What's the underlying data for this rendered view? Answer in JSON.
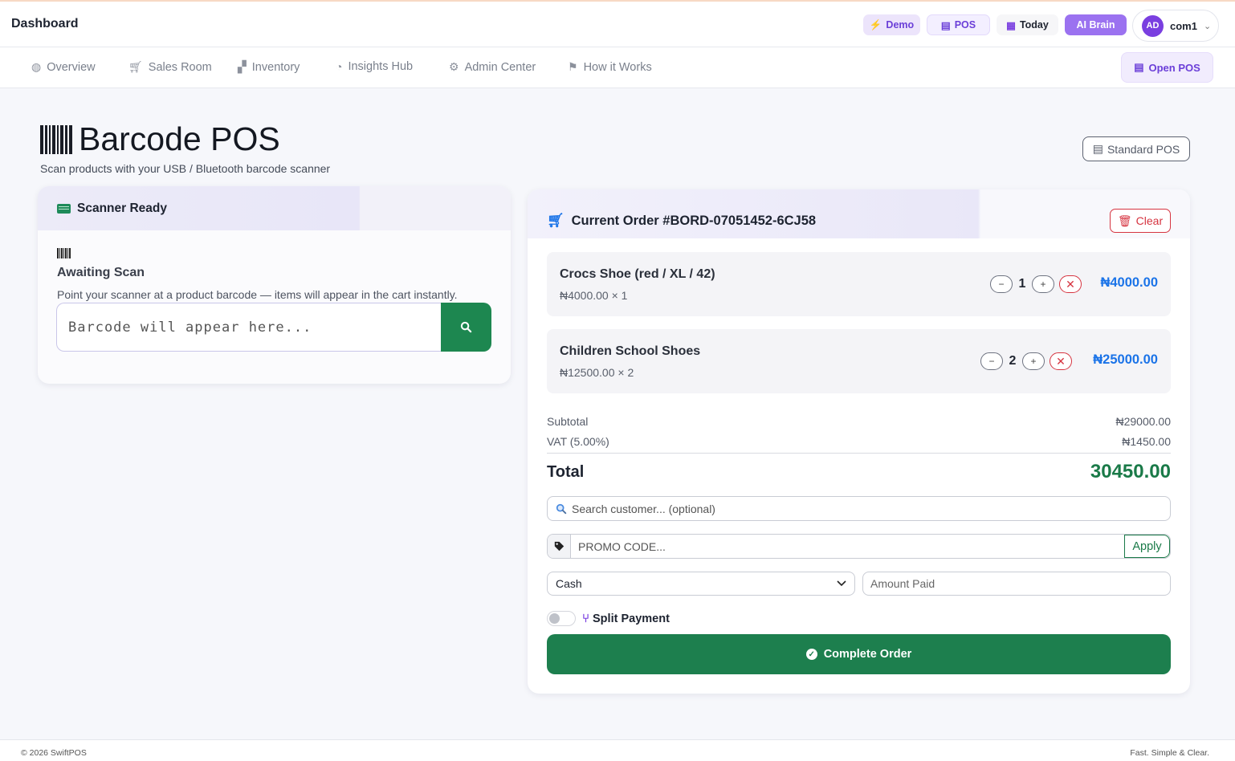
{
  "header": {
    "title": "Dashboard",
    "demo_label": "Demo",
    "pos_label": "POS",
    "today_label": "Today",
    "ai_label": "AI Brain",
    "user_initials": "AD",
    "user_name": "com1"
  },
  "nav": {
    "items": [
      {
        "label": "Overview",
        "icon": "globe-icon"
      },
      {
        "label": "Sales Room",
        "icon": "cart-icon"
      },
      {
        "label": "Inventory",
        "icon": "boxes-icon"
      },
      {
        "label": "Insights Hub",
        "icon": "pie-chart-icon"
      },
      {
        "label": "Admin Center",
        "icon": "gear-icon"
      },
      {
        "label": "How it Works",
        "icon": "signpost-icon"
      }
    ],
    "open_pos_label": "Open POS"
  },
  "page": {
    "title": "Barcode POS",
    "subtitle": "Scan products with your USB / Bluetooth barcode scanner",
    "standard_pos_label": "Standard POS"
  },
  "scanner": {
    "status": "Scanner Ready",
    "await_title": "Awaiting Scan",
    "await_desc": "Point your scanner at a product barcode — items will appear in the cart instantly.",
    "input_placeholder": "Barcode will appear here..."
  },
  "order": {
    "title": "Current Order #BORD-07051452-6CJ58",
    "clear_label": "Clear",
    "items": [
      {
        "name": "Crocs Shoe (red / XL / 42)",
        "unit_line": "₦4000.00 × 1",
        "qty": "1",
        "total": "₦4000.00"
      },
      {
        "name": "Children School Shoes",
        "unit_line": "₦12500.00 × 2",
        "qty": "2",
        "total": "₦25000.00"
      }
    ],
    "subtotal_label": "Subtotal",
    "subtotal_value": "₦29000.00",
    "vat_label": "VAT (5.00%)",
    "vat_value": "₦1450.00",
    "total_label": "Total",
    "total_value": "30450.00",
    "customer_placeholder": "Search customer... (optional)",
    "promo_placeholder": "PROMO CODE...",
    "apply_label": "Apply",
    "payment_method": "Cash",
    "amount_placeholder": "Amount Paid",
    "split_label": "Split Payment",
    "complete_label": "Complete Order"
  },
  "footer": {
    "left": "© 2026 SwiftPOS",
    "right": "Fast. Simple & Clear."
  },
  "colors": {
    "accent_purple": "#6b3fd8",
    "brand_green": "#1d7f4e",
    "price_blue": "#1a73e8",
    "danger_red": "#d63440"
  }
}
